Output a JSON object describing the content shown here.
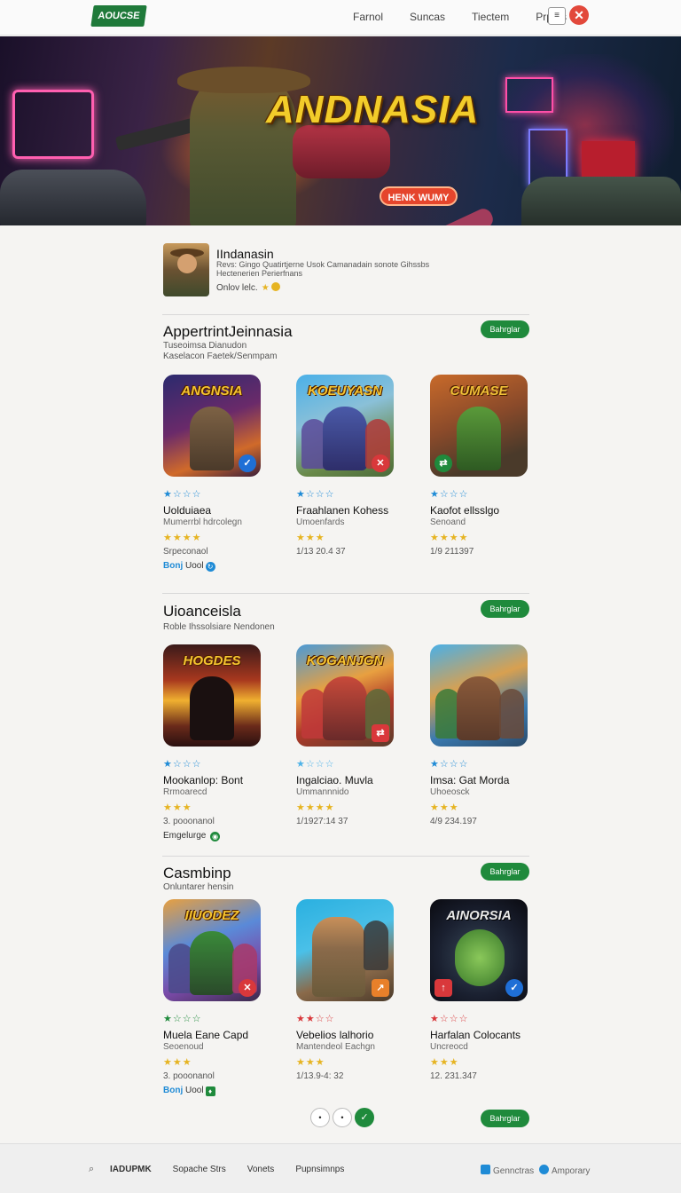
{
  "header": {
    "logo_text": "AOUCSE",
    "nav": [
      "Farnol",
      "Suncas",
      "Tiectem",
      "Prpots"
    ],
    "menu_icon": "≡",
    "close_icon": "✕"
  },
  "hero": {
    "title": "ANDNASIA",
    "button_label": "HENK WUMY"
  },
  "featured": {
    "title": "IIndanasin",
    "description": "Revs: Gingo Quatirtjerne Usok Camanadain sonote Gihssbs Hectenerien Perierfnans",
    "rating_label": "Onlov lelc."
  },
  "sections": [
    {
      "title": "AppertrintJeinnasia",
      "subtitle_1": "Tuseoimsa Dianudon",
      "subtitle_2": "Kaselacon Faetek/Senmpam",
      "more_label": "Bahrglar",
      "apps": [
        {
          "thumb_label": "ANGNSIA",
          "stars": "★☆☆☆",
          "star_color": "#1f8bd6",
          "name": "Uolduiaea",
          "dev": "Mumerrbl hdrcolegn",
          "rating": "★★★★",
          "meta": "Srpeconaol",
          "tag_blue": "Bonj",
          "tag_rest": "Uool",
          "tag_icon": "↻",
          "tag_color": "#1f8bd6"
        },
        {
          "thumb_label": "KOEUYASN",
          "stars": "★☆☆☆",
          "star_color": "#1f8bd6",
          "name": "Fraahlanen Kohess",
          "dev": "Umoenfards",
          "rating": "★★★",
          "meta": "1/13 20.4 37",
          "tag_blue": "",
          "tag_rest": "",
          "tag_icon": "",
          "tag_color": "#1f8bd6"
        },
        {
          "thumb_label": "CUMASE",
          "stars": "★☆☆☆",
          "star_color": "#1f8bd6",
          "name": "Kaofot ellsslgo",
          "dev": "Senoand",
          "rating": "★★★★",
          "meta": "1/9 211397",
          "tag_blue": "",
          "tag_rest": "",
          "tag_icon": "",
          "tag_color": "#1f8bd6"
        }
      ]
    },
    {
      "title": "Uioanceisla",
      "subtitle_1": "Roble Ihssolsiare Nendonen",
      "subtitle_2": "",
      "more_label": "Bahrglar",
      "apps": [
        {
          "thumb_label": "HOGDES",
          "stars": "★☆☆☆",
          "star_color": "#1f8bd6",
          "name": "Mookanlop: Bont",
          "dev": "Rrmoarecd",
          "rating": "★★★",
          "meta": "3. pooonanol",
          "tag_blue": "",
          "tag_rest": "Emgelurge",
          "tag_icon": "◉",
          "tag_color": "#1f8a3c"
        },
        {
          "thumb_label": "KOGANJGN",
          "stars": "★☆☆☆",
          "star_color": "#4fb3e8",
          "name": "Ingalciao. Muvla",
          "dev": "Ummannnido",
          "rating": "★★★★",
          "meta": "1/1927:14 37",
          "tag_blue": "",
          "tag_rest": "",
          "tag_icon": "",
          "tag_color": "#1f8bd6"
        },
        {
          "thumb_label": "",
          "stars": "★☆☆☆",
          "star_color": "#1f8bd6",
          "name": "Imsa: Gat Morda",
          "dev": "Uhoeosck",
          "rating": "★★★",
          "meta": "4/9 234.197",
          "tag_blue": "",
          "tag_rest": "",
          "tag_icon": "",
          "tag_color": "#1f8bd6"
        }
      ]
    },
    {
      "title": "Casmbinp",
      "subtitle_1": "Onluntarer hensin",
      "subtitle_2": "",
      "more_label": "Bahrglar",
      "apps": [
        {
          "thumb_label": "IIUODEZ",
          "stars": "★☆☆☆",
          "star_color": "#1f8a3c",
          "name": "Muela Eane Capd",
          "dev": "Seoenoud",
          "rating": "★★★",
          "meta": "3. pooonanol",
          "tag_blue": "Bonj",
          "tag_rest": "Uool",
          "tag_icon": "♦",
          "tag_color": "#1f8a3c"
        },
        {
          "thumb_label": "",
          "stars": "★★☆☆",
          "star_color": "#d9383b",
          "name": "Vebelios lalhorio",
          "dev": "Mantendeol Eachgn",
          "rating": "★★★",
          "meta": "1/13.9-4: 32",
          "tag_blue": "",
          "tag_rest": "",
          "tag_icon": "",
          "tag_color": "#1f8bd6"
        },
        {
          "thumb_label": "AINORSIA",
          "stars": "★☆☆☆",
          "star_color": "#d9383b",
          "name": "Harfalan Colocants",
          "dev": "Uncreocd",
          "rating": "★★★",
          "meta": "12. 231.347",
          "tag_blue": "",
          "tag_rest": "",
          "tag_icon": "",
          "tag_color": "#1f8bd6"
        }
      ]
    }
  ],
  "pagination": {
    "pages": [
      "•",
      "•",
      "✓"
    ],
    "more_label": "Bahrglar"
  },
  "footer": {
    "search_icon": "⌕",
    "links": [
      "IADUPMK",
      "Sopache Strs",
      "Vonets",
      "Pupnsimnps"
    ],
    "right_1": "Gennctras",
    "right_2": "Amporary"
  },
  "colors": {
    "accent_green": "#1f8a3c",
    "close_red": "#e2483b",
    "hero_gold": "#f2cc2a"
  }
}
